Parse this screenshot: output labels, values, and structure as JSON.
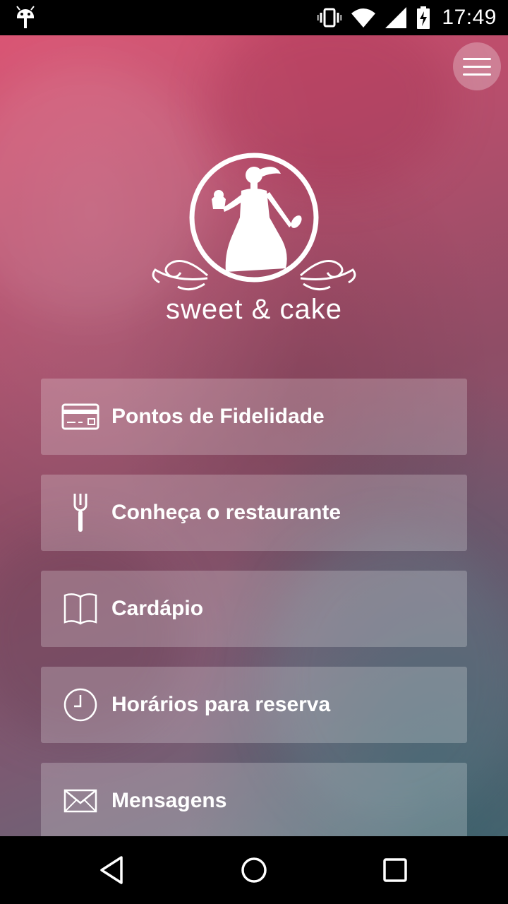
{
  "status_bar": {
    "time": "17:49",
    "icons": [
      "android-icon",
      "vibrate-icon",
      "wifi-icon",
      "signal-icon",
      "battery-charging-icon"
    ]
  },
  "header": {
    "menu_icon": "hamburger-menu-icon"
  },
  "brand": {
    "name": "sweet & cake"
  },
  "menu": {
    "items": [
      {
        "label": "Pontos de Fidelidade",
        "icon": "credit-card-icon"
      },
      {
        "label": "Conheça o restaurante",
        "icon": "fork-icon"
      },
      {
        "label": "Cardápio",
        "icon": "book-icon"
      },
      {
        "label": "Horários para reserva",
        "icon": "clock-icon"
      },
      {
        "label": "Mensagens",
        "icon": "envelope-icon"
      }
    ]
  },
  "nav_bar": {
    "buttons": [
      "back-icon",
      "home-icon",
      "recents-icon"
    ]
  },
  "colors": {
    "accent": "#d84e6e",
    "text": "#ffffff"
  }
}
